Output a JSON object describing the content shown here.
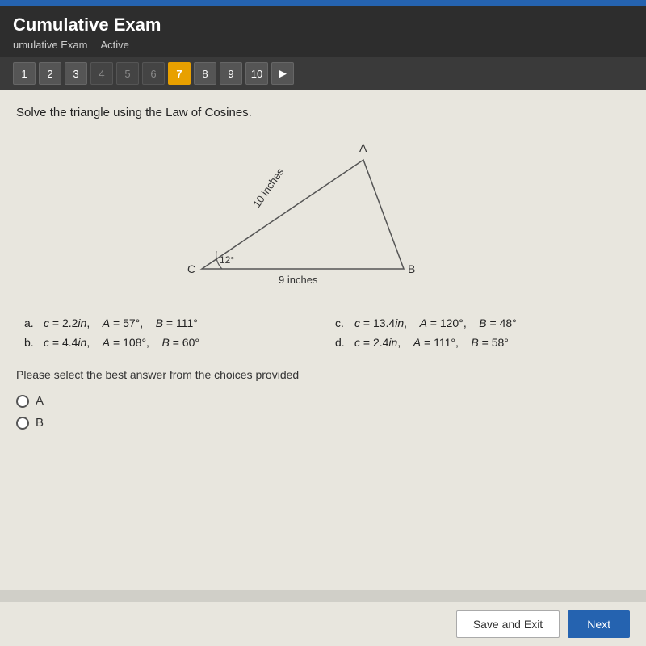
{
  "topbar": {
    "color": "#2563b0"
  },
  "header": {
    "title": "Cumulative Exam",
    "subtitle": "umulative Exam",
    "status": "Active"
  },
  "pagination": {
    "pages": [
      "1",
      "2",
      "3",
      "4",
      "5",
      "6",
      "7",
      "8",
      "9",
      "10"
    ],
    "active_page": "7",
    "next_label": "▶"
  },
  "question": {
    "prompt": "Solve the triangle using the Law of Cosines.",
    "diagram": {
      "label_A": "A",
      "label_B": "B",
      "label_C": "C",
      "side_CA": "10 inches",
      "side_CB": "9 inches",
      "angle_C": "12°"
    },
    "choices": [
      {
        "label": "a.",
        "text": "c = 2.2in,    A = 57°,    B = 111°"
      },
      {
        "label": "c.",
        "text": "c = 13.4in,    A = 120°,    B = 48°"
      },
      {
        "label": "b.",
        "text": "c = 4.4in,    A = 108°,    B = 60°"
      },
      {
        "label": "d.",
        "text": "c = 2.4in,    A = 111°,    B = 58°"
      }
    ],
    "select_prompt": "Please select the best answer from the choices provided",
    "radio_options": [
      "A",
      "B"
    ]
  },
  "buttons": {
    "save_label": "Save and Exit",
    "next_label": "Next"
  }
}
